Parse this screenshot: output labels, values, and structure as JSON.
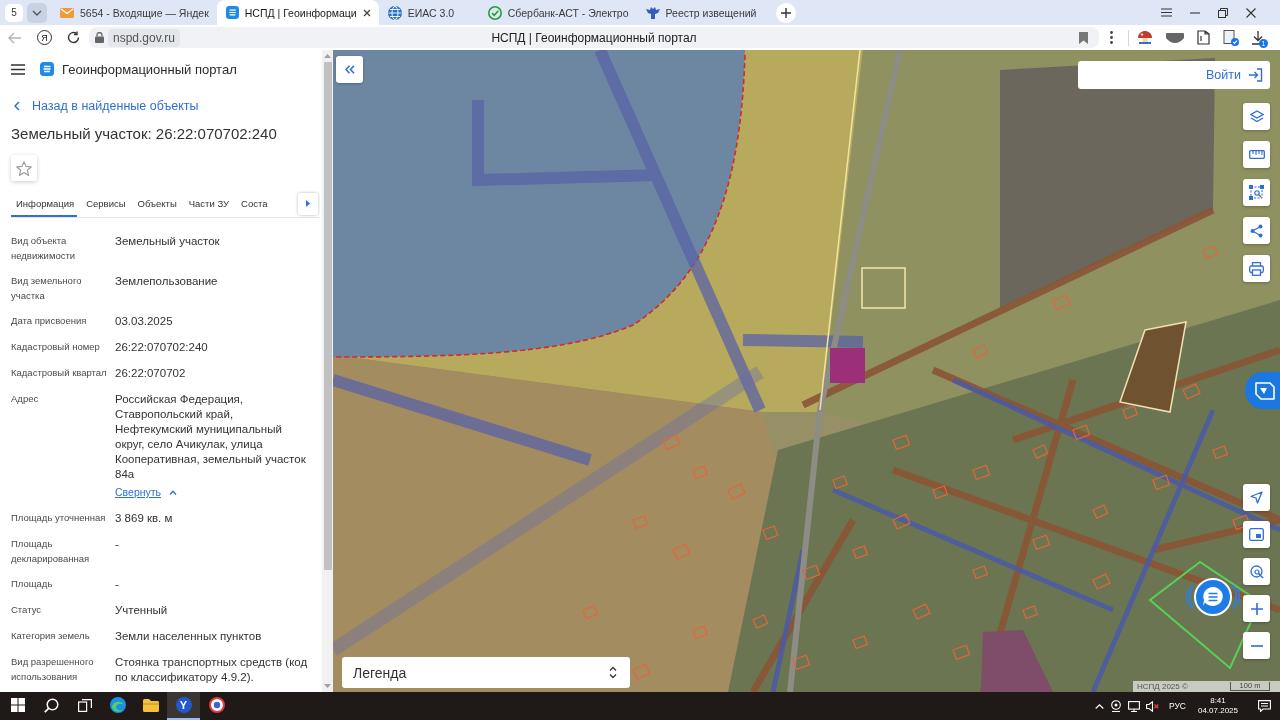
{
  "browser": {
    "tab_count": "5",
    "tabs": [
      {
        "kind": "mail",
        "title": "5654 - Входящие — Яндек",
        "selected": false
      },
      {
        "kind": "portal",
        "title": "НСПД | Геоинформаци",
        "selected": true
      },
      {
        "kind": "globe",
        "title": "ЕИАС 3.0",
        "selected": false
      },
      {
        "kind": "check",
        "title": "Сбербанк-АСТ - Электро",
        "selected": false
      },
      {
        "kind": "emblem",
        "title": "Реестр извещений",
        "selected": false
      }
    ],
    "back_disabled": true,
    "home_button": "Я",
    "url": "nspd.gov.ru",
    "page_title": "НСПД | Геоинформационный портал",
    "download_count": "1"
  },
  "panel": {
    "portal_name": "Геоинформационный портал",
    "back_link": "Назад в найденные объекты",
    "title": "Земельный участок: 26:22:070702:240",
    "tabs": [
      {
        "label": "Информация",
        "selected": true
      },
      {
        "label": "Сервисы",
        "selected": false
      },
      {
        "label": "Объекты",
        "selected": false
      },
      {
        "label": "Части ЗУ",
        "selected": false
      },
      {
        "label": "Соста",
        "selected": false
      }
    ],
    "properties": [
      {
        "label": "Вид объекта недвижимости",
        "value": "Земельный участок"
      },
      {
        "label": "Вид земельного участка",
        "value": "Землепользование"
      },
      {
        "label": "Дата присвоения",
        "value": "03.03.2025"
      },
      {
        "label": "Кадастровый номер",
        "value": "26:22:070702:240"
      },
      {
        "label": "Кадастровый квартал",
        "value": "26:22:070702"
      },
      {
        "label": "Адрес",
        "value": "Российская Федерация, Ставропольский край, Нефтекумский муниципальный округ, село Ачикулак, улица Кооперативная, земельный участок 84а",
        "collapse_link": "Свернуть"
      },
      {
        "label": "Площадь уточненная",
        "value": "3 869 кв. м"
      },
      {
        "label": "Площадь декларированная",
        "value": "-"
      },
      {
        "label": "Площадь",
        "value": "-"
      },
      {
        "label": "Статус",
        "value": "Учтенный"
      },
      {
        "label": "Категория земель",
        "value": "Земли населенных пунктов"
      },
      {
        "label": "Вид разрешенного использования",
        "value": "Стоянка транспортных средств (код по классификатору 4.9.2)."
      }
    ]
  },
  "map": {
    "login": "Войти",
    "legend": "Легенда",
    "attribution": "НСПД 2025 ©",
    "scale": "100 m"
  },
  "taskbar": {
    "apps": [
      {
        "kind": "swirl",
        "selected": false
      },
      {
        "kind": "folder",
        "selected": false
      },
      {
        "kind": "letter",
        "letter": "Y",
        "selected": true
      },
      {
        "kind": "target",
        "selected": false
      }
    ],
    "language": "РУС",
    "time": "8:41",
    "date": "04.07.2025"
  }
}
